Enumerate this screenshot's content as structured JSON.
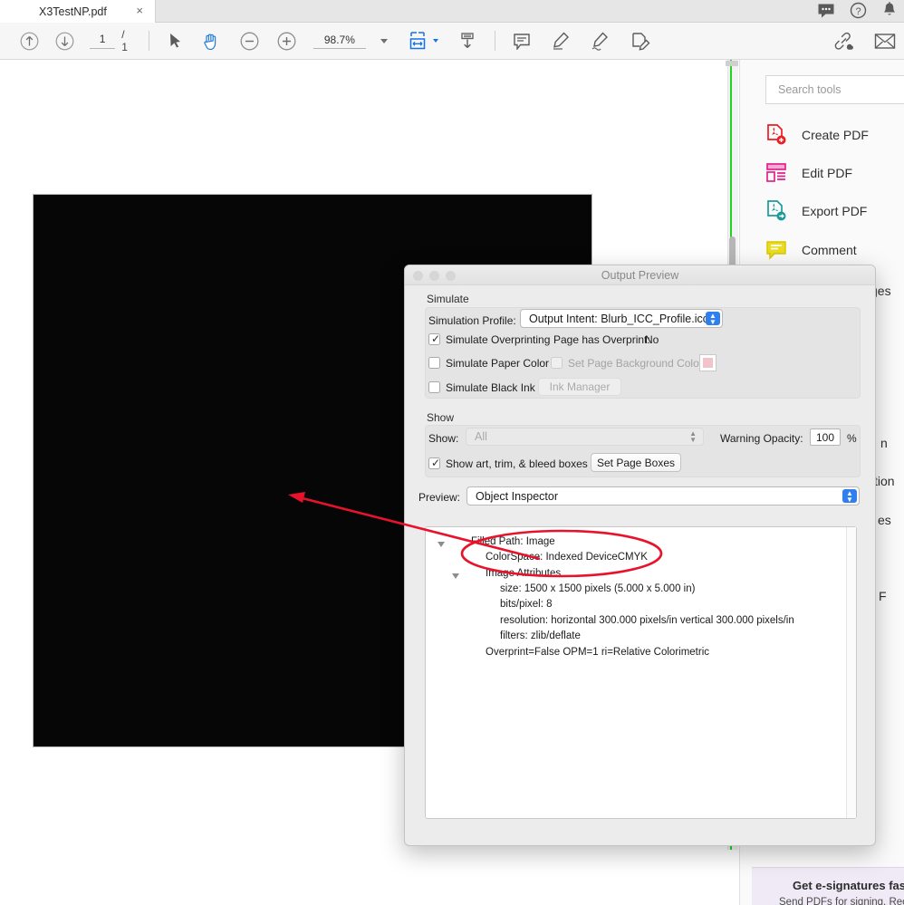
{
  "window": {
    "tab_title": "X3TestNP.pdf",
    "close_label": "×"
  },
  "header_icons": [
    {
      "name": "comment-dots-icon"
    },
    {
      "name": "help-icon"
    },
    {
      "name": "bell-icon"
    }
  ],
  "toolbar": {
    "page_up": "↑",
    "page_down": "↓",
    "page_current": "1",
    "page_total": "/ 1",
    "select_tool": "select-cursor",
    "hand_tool": "hand",
    "zoom_out": "−",
    "zoom_in": "+",
    "zoom_value": "98.7%",
    "fit_label": "fit-page",
    "download_label": "download",
    "comment_label": "comment",
    "highlight_label": "highlight",
    "sign_label": "sign",
    "fill_sign_label": "fill-and-sign",
    "share_link_label": "share-link",
    "email_label": "email"
  },
  "tools_panel": {
    "search_placeholder": "Search tools",
    "items": [
      {
        "label": "Create PDF",
        "icon": "create-pdf-icon",
        "color": "#ec1c24"
      },
      {
        "label": "Edit PDF",
        "icon": "edit-pdf-icon",
        "color": "#e0218a"
      },
      {
        "label": "Export PDF",
        "icon": "export-pdf-icon",
        "color": "#1a9b9b"
      },
      {
        "label": "Comment",
        "icon": "comment-icon",
        "color": "#d6c600"
      }
    ],
    "clipped_items": [
      {
        "label": "ges"
      },
      {
        "label": "n"
      },
      {
        "label": "tion"
      },
      {
        "label": "es"
      },
      {
        "label": "F"
      }
    ],
    "promo_title": "Get e-signatures fas",
    "promo_sub": "Send PDFs for signing. Recip"
  },
  "dialog": {
    "title": "Output Preview",
    "simulate": {
      "group_label": "Simulate",
      "profile_label": "Simulation Profile:",
      "profile_value": "Output Intent: Blurb_ICC_Profile.icc",
      "simulate_overprinting_label": "Simulate Overprinting",
      "simulate_overprinting_checked": true,
      "page_has_overprint_label": "Page has Overprint:",
      "page_has_overprint_value": "No",
      "simulate_paper_color_label": "Simulate Paper Color",
      "simulate_paper_color_checked": false,
      "set_page_bg_label": "Set Page Background Color",
      "set_page_bg_checked": false,
      "bg_swatch_color": "#f2c4c9",
      "simulate_black_ink_label": "Simulate Black Ink",
      "simulate_black_ink_checked": false,
      "ink_manager_label": "Ink Manager"
    },
    "show": {
      "group_label": "Show",
      "show_label": "Show:",
      "show_value": "All",
      "warning_opacity_label": "Warning Opacity:",
      "warning_opacity_value": "100",
      "percent_label": "%",
      "boxes_label": "Show art, trim, & bleed boxes",
      "boxes_checked": true,
      "set_page_boxes_label": "Set Page Boxes"
    },
    "preview": {
      "label": "Preview:",
      "value": "Object Inspector"
    },
    "inspector_tree": [
      {
        "text": "Filled Path: Image",
        "indent": 0,
        "disclosure": true
      },
      {
        "text": "ColorSpace: Indexed DeviceCMYK",
        "indent": 1,
        "disclosure": false
      },
      {
        "text": "Image Attributes",
        "indent": 1,
        "disclosure": true
      },
      {
        "text": "size: 1500 x 1500 pixels (5.000 x 5.000 in)",
        "indent": 2,
        "disclosure": false
      },
      {
        "text": "bits/pixel: 8",
        "indent": 2,
        "disclosure": false
      },
      {
        "text": "resolution: horizontal 300.000 pixels/in vertical 300.000 pixels/in",
        "indent": 2,
        "disclosure": false
      },
      {
        "text": "filters: zlib/deflate",
        "indent": 2,
        "disclosure": false
      },
      {
        "text": "Overprint=False OPM=1 ri=Relative Colorimetric",
        "indent": 1,
        "disclosure": false
      }
    ]
  },
  "annotation": {
    "color": "#e8132b",
    "ellipse_target": "ColorSpace: Indexed DeviceCMYK",
    "arrow_label": "red-arrow"
  }
}
